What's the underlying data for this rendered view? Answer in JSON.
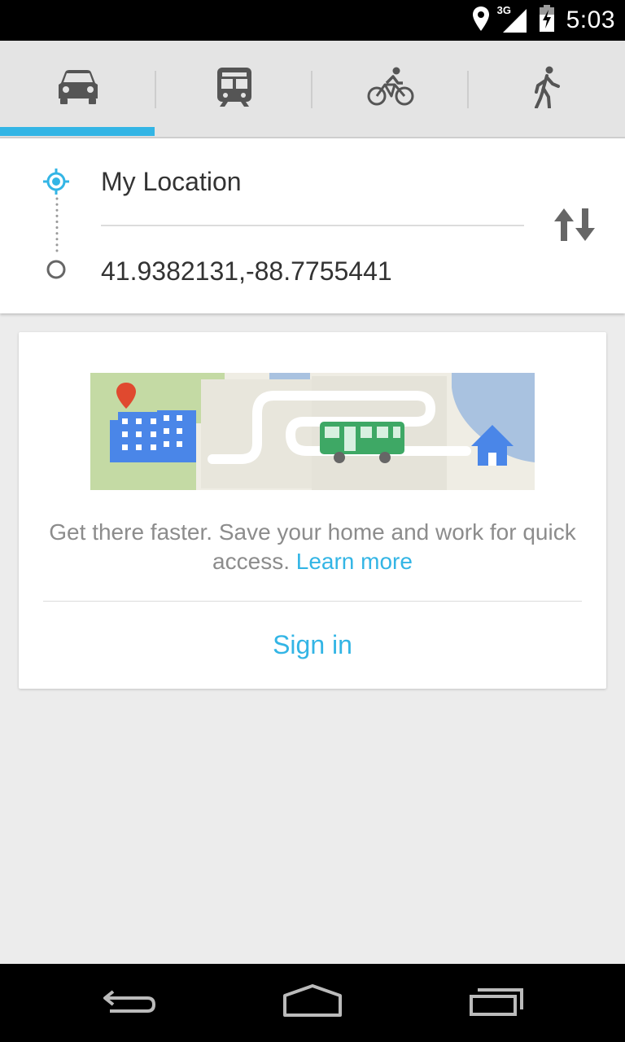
{
  "status_bar": {
    "network_label": "3G",
    "time": "5:03",
    "icons": [
      "location-icon",
      "signal-icon",
      "battery-icon"
    ]
  },
  "mode_tabs": [
    {
      "name": "Driving",
      "icon": "car-icon",
      "selected": true
    },
    {
      "name": "Transit",
      "icon": "train-icon",
      "selected": false
    },
    {
      "name": "Bicycling",
      "icon": "bike-icon",
      "selected": false
    },
    {
      "name": "Walking",
      "icon": "walk-icon",
      "selected": false
    }
  ],
  "route": {
    "origin": "My Location",
    "destination": "41.9382131,-88.7755441",
    "swap_icon": "swap-arrows-icon"
  },
  "promo": {
    "text": "Get there faster. Save your home and work for quick access.",
    "link": "Learn more",
    "action": "Sign in"
  },
  "nav_bar": [
    "back-icon",
    "home-icon",
    "recents-icon"
  ],
  "colors": {
    "accent": "#33b5e5",
    "status_bar": "#000000",
    "tab_bg": "#e4e4e4",
    "page_bg": "#ececec",
    "promo_text": "#8c8c8c"
  }
}
